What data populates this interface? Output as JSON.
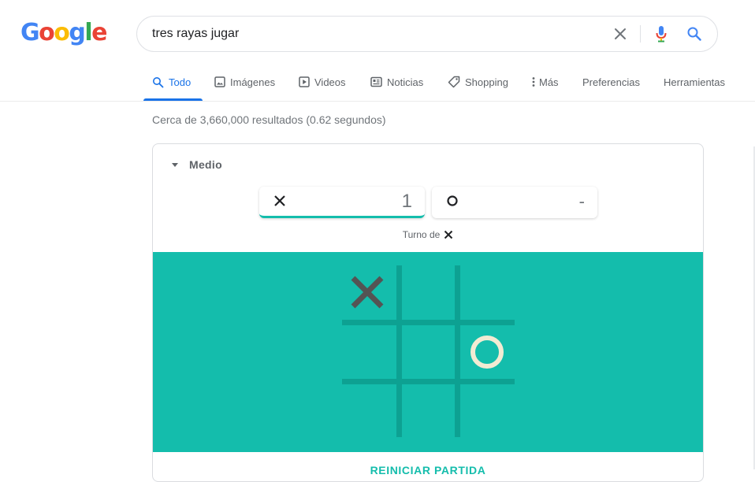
{
  "logo": {
    "letters": [
      "G",
      "o",
      "o",
      "g",
      "l",
      "e"
    ],
    "colors": [
      "#4285f4",
      "#ea4335",
      "#fbbc05",
      "#4285f4",
      "#34a853",
      "#ea4335"
    ]
  },
  "search": {
    "query": "tres rayas jugar"
  },
  "tabs": [
    {
      "label": "Todo",
      "icon": "search-icon",
      "active": true
    },
    {
      "label": "Imágenes",
      "icon": "image-icon",
      "active": false
    },
    {
      "label": "Videos",
      "icon": "play-icon",
      "active": false
    },
    {
      "label": "Noticias",
      "icon": "news-icon",
      "active": false
    },
    {
      "label": "Shopping",
      "icon": "tag-icon",
      "active": false
    },
    {
      "label": "Más",
      "icon": "more-vert-icon",
      "active": false
    },
    {
      "label": "Preferencias",
      "icon": "",
      "active": false
    },
    {
      "label": "Herramientas",
      "icon": "",
      "active": false
    }
  ],
  "results": {
    "stats": "Cerca de 3,660,000 resultados (0.62 segundos)"
  },
  "game": {
    "difficulty": "Medio",
    "scores": {
      "x": "1",
      "o": "-"
    },
    "turn_label": "Turno de",
    "board": [
      [
        "X",
        "",
        ""
      ],
      [
        "",
        "",
        "O"
      ],
      [
        "",
        "",
        ""
      ]
    ],
    "reset_label": "REINICIAR PARTIDA",
    "colors": {
      "board": "#14bdac",
      "grid": "#0da192",
      "x_mark": "#545454",
      "o_mark": "#f2ebd3"
    }
  }
}
